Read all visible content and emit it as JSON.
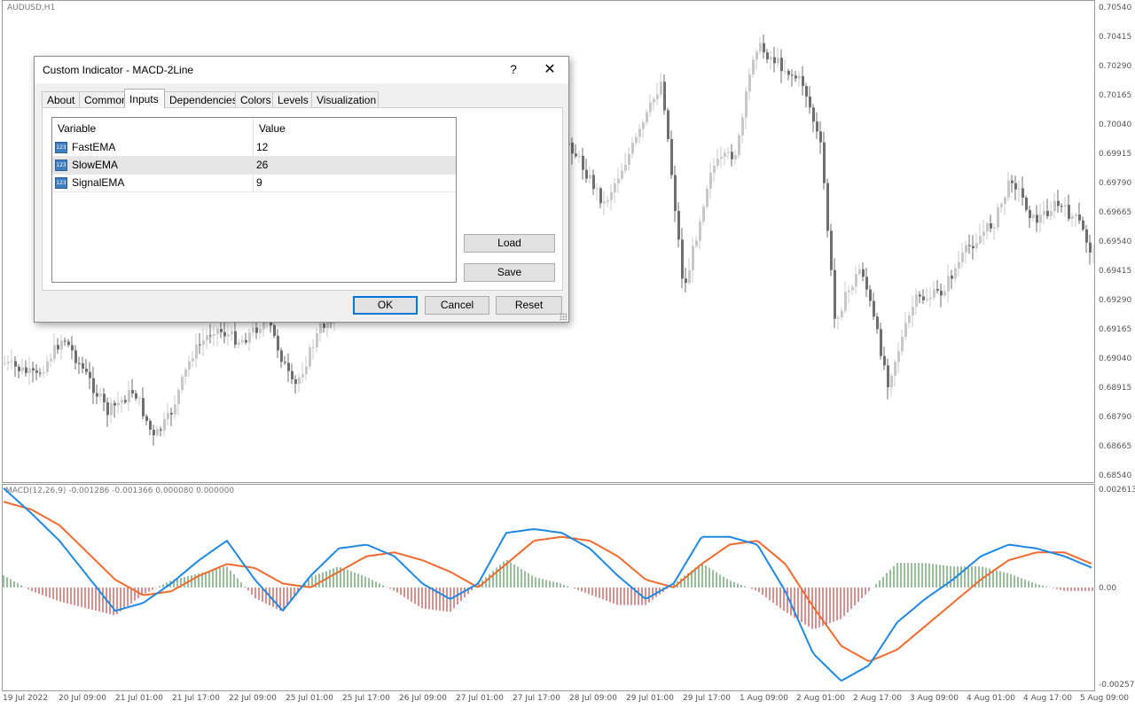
{
  "chart": {
    "symbol": "AUDUSD,H1",
    "price_axis": [
      "0.70540",
      "0.70415",
      "0.70290",
      "0.70165",
      "0.70040",
      "0.69915",
      "0.69790",
      "0.69665",
      "0.69540",
      "0.69415",
      "0.69290",
      "0.69165",
      "0.69040",
      "0.68915",
      "0.68790",
      "0.68665",
      "0.68540"
    ],
    "time_axis": [
      "19 Jul 2022",
      "20 Jul 09:00",
      "21 Jul 01:00",
      "21 Jul 17:00",
      "22 Jul 09:00",
      "25 Jul 01:00",
      "25 Jul 17:00",
      "26 Jul 09:00",
      "27 Jul 01:00",
      "27 Jul 17:00",
      "28 Jul 09:00",
      "29 Jul 01:00",
      "29 Jul 17:00",
      "1 Aug 09:00",
      "2 Aug 01:00",
      "2 Aug 17:00",
      "3 Aug 09:00",
      "4 Aug 01:00",
      "4 Aug 17:00",
      "5 Aug 09:00"
    ],
    "colors": {
      "bull": "#c8c8c8",
      "bear": "#6e6e6e",
      "macd_line": "#1e88e5",
      "signal_line": "#f26a2e",
      "hist_pos": "#2e7d32",
      "hist_neg": "#b71c1c"
    }
  },
  "indicator": {
    "label": "MACD(12,26,9) -0.001286 -0.001366 0.000080 0.000000",
    "axis": [
      "0.002613",
      "0.00",
      "-0.002575"
    ]
  },
  "dialog": {
    "title": "Custom Indicator - MACD-2Line",
    "help": "?",
    "close": "✕",
    "tabs": [
      "About",
      "Common",
      "Inputs",
      "Dependencies",
      "Colors",
      "Levels",
      "Visualization"
    ],
    "active_tab": "Inputs",
    "grid": {
      "headers": [
        "Variable",
        "Value"
      ],
      "rows": [
        {
          "variable": "FastEMA",
          "value": "12",
          "icon": "123-icon"
        },
        {
          "variable": "SlowEMA",
          "value": "26",
          "icon": "123-icon"
        },
        {
          "variable": "SignalEMA",
          "value": "9",
          "icon": "123-icon"
        }
      ],
      "icon_text": "123"
    },
    "buttons": {
      "load": "Load",
      "save": "Save",
      "ok": "OK",
      "cancel": "Cancel",
      "reset": "Reset"
    }
  },
  "chart_data": {
    "type": "line",
    "series": [
      {
        "values": [
          0.00255,
          0.0019,
          0.0012,
          0.0003,
          -0.0006,
          -0.0004,
          0.0001,
          0.0007,
          0.0012,
          0.0002,
          -0.0006,
          0.0003,
          0.001,
          0.0011,
          0.0008,
          0.0001,
          -0.0003,
          0.0001,
          0.0014,
          0.0015,
          0.0014,
          0.001,
          0.0003,
          -0.0003,
          0.0001,
          0.0013,
          0.0013,
          0.0011,
          -0.0001,
          -0.0017,
          -0.0024,
          -0.002,
          -0.0009,
          -0.0003,
          0.0002,
          0.0008,
          0.0011,
          0.001,
          0.0008,
          0.0005
        ]
      },
      {
        "values": [
          0.0022,
          0.002,
          0.0016,
          0.0009,
          0.0002,
          -0.0002,
          -0.0001,
          0.0003,
          0.0006,
          0.0005,
          0.0001,
          0.0,
          0.0004,
          0.0008,
          0.0009,
          0.0007,
          0.0004,
          0.0,
          0.0006,
          0.0012,
          0.0013,
          0.0012,
          0.0008,
          0.0002,
          0.0,
          0.0006,
          0.0011,
          0.0012,
          0.0006,
          -0.0005,
          -0.0015,
          -0.0019,
          -0.0016,
          -0.001,
          -0.0004,
          0.0002,
          0.0007,
          0.0009,
          0.0009,
          0.0006
        ]
      }
    ],
    "ylim": [
      -0.002575,
      0.002613
    ]
  }
}
